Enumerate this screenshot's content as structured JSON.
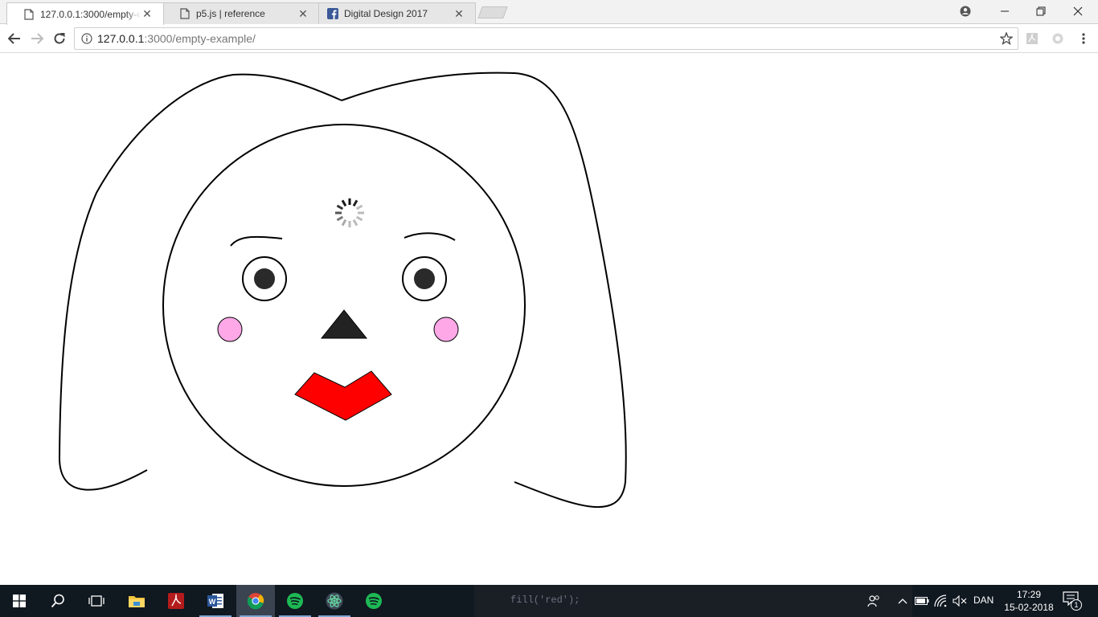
{
  "browser": {
    "tabs": [
      {
        "title": "127.0.0.1:3000/empty-ex",
        "favicon": "page-icon",
        "active": true
      },
      {
        "title": "p5.js | reference",
        "favicon": "page-icon",
        "active": false
      },
      {
        "title": "Digital Design 2017",
        "favicon": "facebook-icon",
        "active": false
      }
    ],
    "url_host": "127.0.0.1",
    "url_rest": ":3000/empty-example/",
    "colors": {
      "facebook": "#3b5998",
      "toolbar_bg": "#ffffff",
      "tabstrip_bg": "#f2f2f2"
    }
  },
  "sketch": {
    "face_fill": "#ffffff",
    "outline": "#000000",
    "pupil_color": "#2a2a2a",
    "cheek_color": "#ffa8e8",
    "nose_color": "#222222",
    "lip_color": "#ff0000",
    "loading_spinner": true
  },
  "taskbar": {
    "apps": [
      "windows-start-icon",
      "search-icon",
      "task-view-icon",
      "file-explorer-icon",
      "pdf-app-icon",
      "word-icon",
      "chrome-icon",
      "spotify-alt-icon",
      "atom-icon",
      "spotify-icon"
    ],
    "code_peek": "fill('red');",
    "language": "DAN",
    "time": "17:29",
    "date": "15-02-2018",
    "notification_count": "1",
    "colors": {
      "bg": "#101820",
      "spotify": "#1db954",
      "atom": "#66d9a0",
      "chrome_red": "#db4437"
    }
  }
}
